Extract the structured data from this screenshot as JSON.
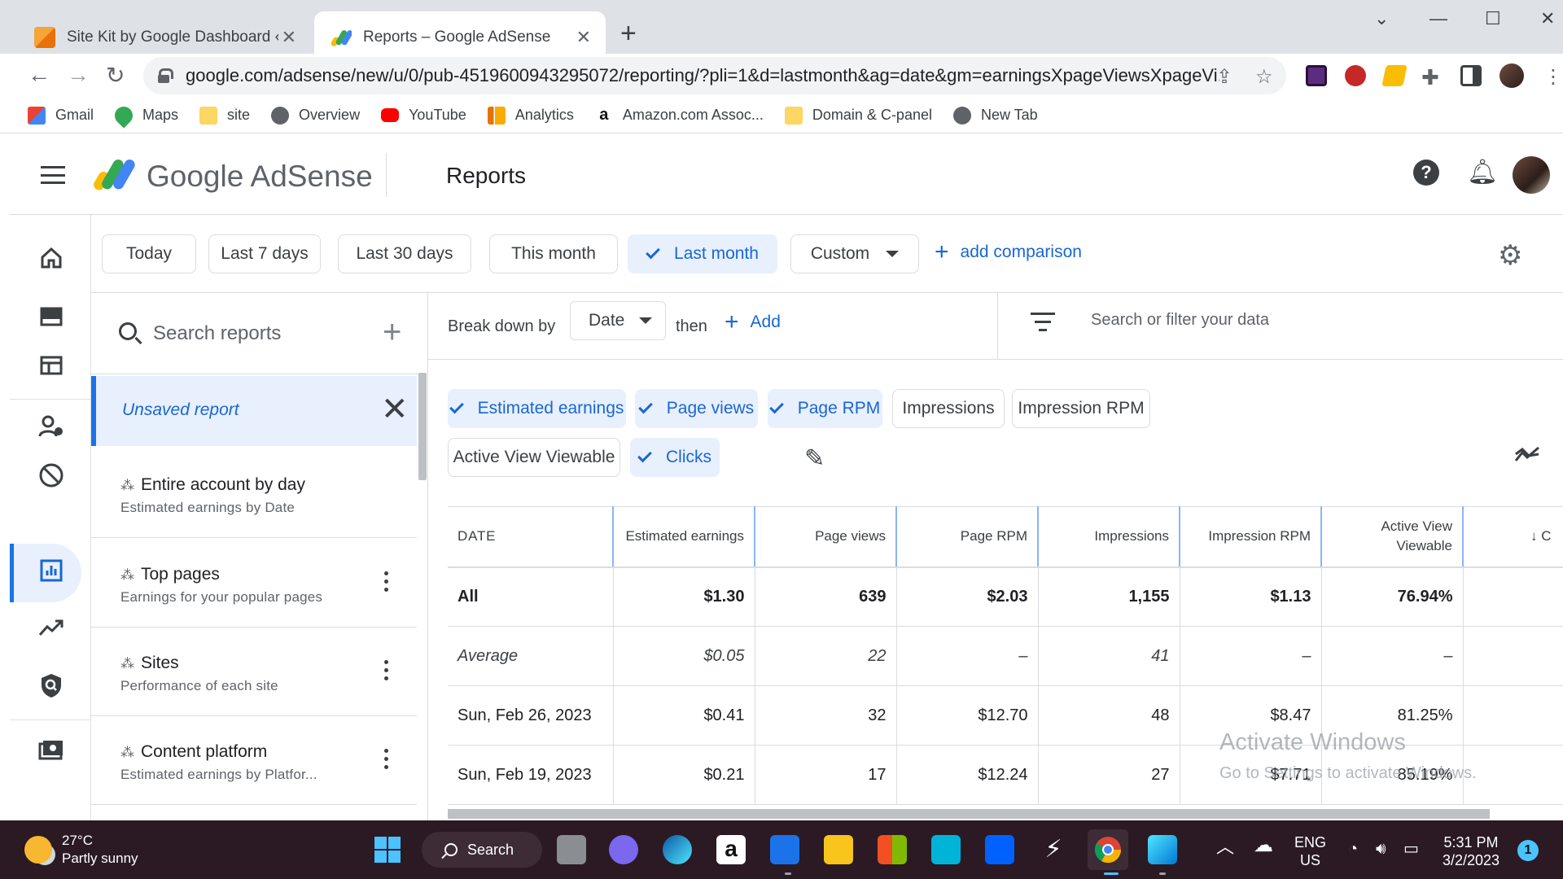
{
  "browser": {
    "tabs": [
      {
        "title": "Site Kit by Google Dashboard ‹ E",
        "active": false
      },
      {
        "title": "Reports – Google AdSense",
        "active": true
      }
    ],
    "url": "google.com/adsense/new/u/0/pub-4519600943295072/reporting/?pli=1&d=lastmonth&ag=date&gm=earningsXpageViewsXpageVi...",
    "bookmarks": [
      "Gmail",
      "Maps",
      "site",
      "Overview",
      "YouTube",
      "Analytics",
      "Amazon.com Assoc...",
      "Domain & C-panel",
      "New Tab"
    ]
  },
  "header": {
    "brand": "Google AdSense",
    "title": "Reports"
  },
  "date_ranges": {
    "today": "Today",
    "last7": "Last 7 days",
    "last30": "Last 30 days",
    "this_month": "This month",
    "last_month": "Last month",
    "custom": "Custom",
    "selected": "Last month",
    "add_comparison": "add comparison"
  },
  "reports_panel": {
    "search_placeholder": "Search reports",
    "unsaved": "Unsaved report",
    "items": [
      {
        "title": "Entire account by day",
        "subtitle": "Estimated earnings by Date"
      },
      {
        "title": "Top pages",
        "subtitle": "Earnings for your popular pages"
      },
      {
        "title": "Sites",
        "subtitle": "Performance of each site"
      },
      {
        "title": "Content platform",
        "subtitle": "Estimated earnings by Platfor..."
      }
    ]
  },
  "breakdown": {
    "label": "Break down by",
    "value": "Date",
    "then": "then",
    "add": "Add"
  },
  "filter": {
    "placeholder": "Search or filter your data"
  },
  "metrics": {
    "estimated_earnings": "Estimated earnings",
    "page_views": "Page views",
    "page_rpm": "Page RPM",
    "impressions": "Impressions",
    "impression_rpm": "Impression RPM",
    "active_view": "Active View Viewable",
    "clicks": "Clicks"
  },
  "table": {
    "headers": {
      "date": "DATE",
      "earnings": "Estimated earnings",
      "page_views": "Page views",
      "page_rpm": "Page RPM",
      "impressions": "Impressions",
      "impression_rpm": "Impression RPM",
      "active_view": "Active View Viewable",
      "next": "↓ C"
    },
    "rows": [
      {
        "label": "All",
        "earnings": "$1.30",
        "page_views": "639",
        "page_rpm": "$2.03",
        "impressions": "1,155",
        "impression_rpm": "$1.13",
        "active_view": "76.94%"
      },
      {
        "label": "Average",
        "earnings": "$0.05",
        "page_views": "22",
        "page_rpm": "–",
        "impressions": "41",
        "impression_rpm": "–",
        "active_view": "–"
      },
      {
        "label": "Sun, Feb 26, 2023",
        "earnings": "$0.41",
        "page_views": "32",
        "page_rpm": "$12.70",
        "impressions": "48",
        "impression_rpm": "$8.47",
        "active_view": "81.25%"
      },
      {
        "label": "Sun, Feb 19, 2023",
        "earnings": "$0.21",
        "page_views": "17",
        "page_rpm": "$12.24",
        "impressions": "27",
        "impression_rpm": "$7.71",
        "active_view": "85.19%"
      }
    ]
  },
  "watermark": {
    "line1": "Activate Windows",
    "line2": "Go to Settings to activate Windows."
  },
  "taskbar": {
    "temperature": "27°C",
    "weather": "Partly sunny",
    "search": "Search",
    "lang1": "ENG",
    "lang2": "US",
    "time": "5:31 PM",
    "date": "3/2/2023",
    "notifications": "1"
  },
  "colors": {
    "accent": "#1a73e8",
    "selected_bg": "#e8f0fe",
    "taskbar": "#2b1a24"
  }
}
